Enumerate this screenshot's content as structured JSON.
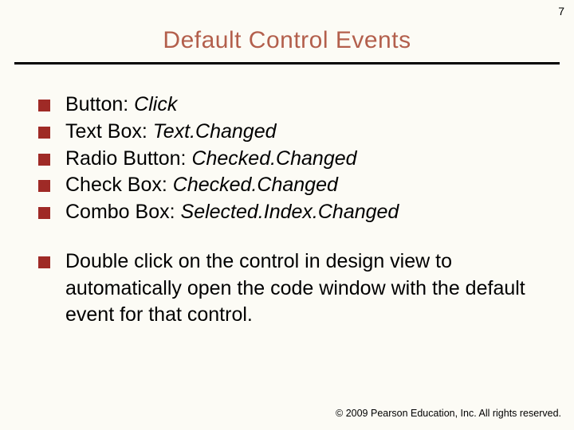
{
  "page_number": "7",
  "title": "Default Control Events",
  "colors": {
    "title": "#b35f4c",
    "bullet": "#9f2a26",
    "background": "#fcfbf5"
  },
  "items": [
    {
      "control": "Button: ",
      "event": "Click"
    },
    {
      "control": "Text Box: ",
      "event": "Text.Changed"
    },
    {
      "control": "Radio Button: ",
      "event": "Checked.Changed"
    },
    {
      "control": "Check Box: ",
      "event": "Checked.Changed"
    },
    {
      "control": "Combo Box: ",
      "event": "Selected.Index.Changed"
    }
  ],
  "note": "Double click on the control in design view to automatically open the code window with the default event for that control.",
  "footer": "© 2009 Pearson Education, Inc.  All rights reserved."
}
